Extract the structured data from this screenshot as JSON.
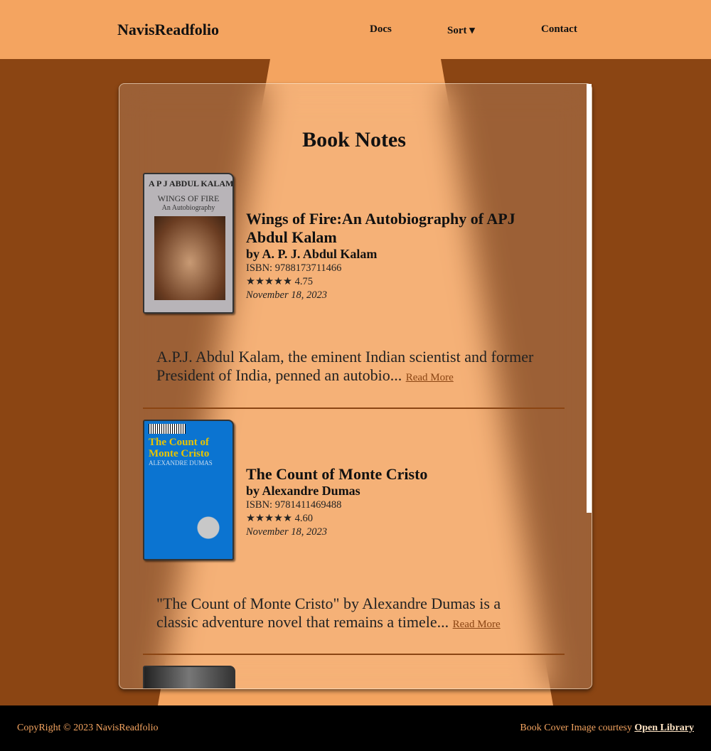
{
  "header": {
    "logo": "NavisReadfolio",
    "nav": [
      "Docs",
      "Sort ▾",
      "Contact"
    ]
  },
  "main": {
    "title": "Book Notes",
    "books": [
      {
        "title": "Wings of Fire:An Autobiography of APJ Abdul Kalam",
        "author": "by A. P. J. Abdul Kalam",
        "isbn": "ISBN: 9788173711466",
        "rating": "★★★★★ 4.75",
        "date": "November 18, 2023",
        "excerpt": "A.P.J. Abdul Kalam, the eminent Indian scientist and former President of India, penned an autobio...",
        "read_more": "Read More",
        "cover_text": [
          "A P J ABDUL KALAM",
          "WINGS OF FIRE",
          "An Autobiography"
        ]
      },
      {
        "title": "The Count of Monte Cristo",
        "author": "by Alexandre Dumas",
        "isbn": "ISBN: 9781411469488",
        "rating": "★★★★★ 4.60",
        "date": "November 18, 2023",
        "excerpt": "\"The Count of Monte Cristo\" by Alexandre Dumas is a classic adventure novel that remains a timele...",
        "read_more": "Read More",
        "cover_text": [
          "The Count of Monte Cristo",
          "ALEXANDRE DUMAS"
        ]
      }
    ]
  },
  "footer": {
    "copyright": "CopyRight © 2023 NavisReadfolio",
    "credit": "Book Cover Image courtesy",
    "credit_link": "Open Library"
  },
  "colors": {
    "header": "#F4A460",
    "background": "#8B4513",
    "footer": "#000000"
  }
}
